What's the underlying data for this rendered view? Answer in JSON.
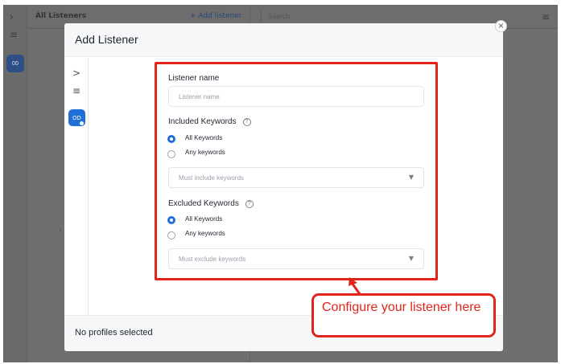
{
  "background_app": {
    "title": "All Listeners",
    "add_listener": "+ Add listener",
    "search_placeholder": "Search",
    "avatar_initials": "OD"
  },
  "modal": {
    "title": "Add Listener",
    "close_glyph": "×",
    "rail": {
      "expand_glyph": ">",
      "filter_glyph": "≡",
      "avatar_initials": "OD"
    },
    "footer_text": "No profiles selected"
  },
  "form": {
    "listener_name": {
      "label": "Listener name",
      "placeholder": "Listener name"
    },
    "included": {
      "label": "Included Keywords",
      "help_glyph": "?",
      "options": [
        "All Keywords",
        "Any keywords"
      ],
      "selected": "All Keywords",
      "select_placeholder": "Must include keywords"
    },
    "excluded": {
      "label": "Excluded Keywords",
      "help_glyph": "?",
      "options": [
        "All Keywords",
        "Any keywords"
      ],
      "selected": "All Keywords",
      "select_placeholder": "Must exclude keywords"
    }
  },
  "annotation": {
    "text": "Configure your listener here",
    "color": "#e0261c"
  },
  "colors": {
    "accent": "#1f6fd6",
    "overlay": "#6f6f6f"
  }
}
